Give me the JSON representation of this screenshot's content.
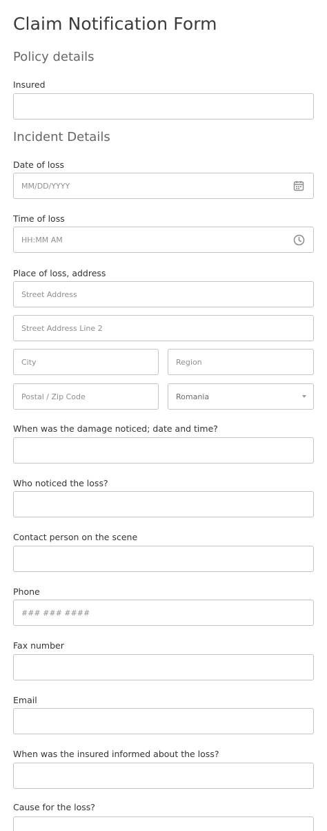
{
  "form": {
    "title": "Claim Notification Form",
    "sections": {
      "policy": "Policy details",
      "incident": "Incident Details"
    },
    "fields": {
      "insured": {
        "label": "Insured",
        "value": ""
      },
      "date_of_loss": {
        "label": "Date of loss",
        "placeholder": "MM/DD/YYYY",
        "icon": "calendar-icon"
      },
      "time_of_loss": {
        "label": "Time of loss",
        "placeholder": "HH:MM AM",
        "icon": "clock-icon"
      },
      "place_of_loss": {
        "label": "Place of loss, address",
        "street": "Street Address",
        "street2": "Street Address Line 2",
        "city": "City",
        "region": "Region",
        "postal": "Postal / Zip Code",
        "country": "Romania"
      },
      "damage_noticed": {
        "label": "When was the damage noticed; date and time?"
      },
      "who_noticed": {
        "label": "Who noticed the loss?"
      },
      "contact_person": {
        "label": "Contact person on the scene"
      },
      "phone": {
        "label": "Phone",
        "placeholder": "### ### ####"
      },
      "fax": {
        "label": "Fax number"
      },
      "email": {
        "label": "Email"
      },
      "insured_informed": {
        "label": "When was the insured informed about the loss?"
      },
      "cause": {
        "label": "Cause for the loss?"
      }
    }
  }
}
